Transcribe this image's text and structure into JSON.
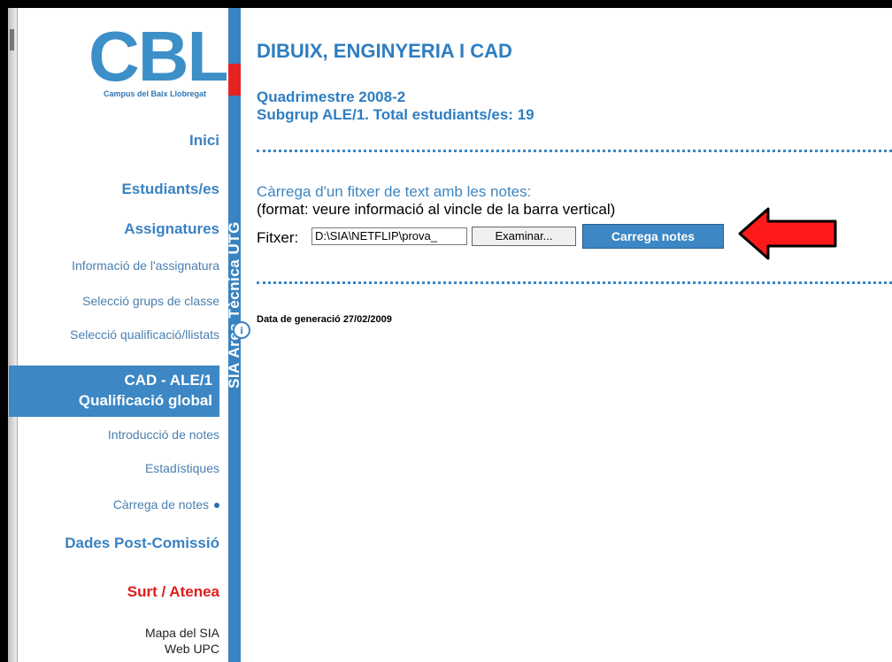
{
  "logo": {
    "word": "CBL",
    "subtitle": "Campus del Baix Llobregat"
  },
  "sidebar": {
    "items": [
      {
        "label": "Inici"
      },
      {
        "label": "Estudiants/es"
      },
      {
        "label": "Assignatures"
      },
      {
        "label": "Informació de l'assignatura"
      },
      {
        "label": "Selecció grups de classe"
      },
      {
        "label": "Selecció qualificació/llistats"
      },
      {
        "label": "Introducció de notes"
      },
      {
        "label": "Estadístiques"
      },
      {
        "label": "Càrrega de notes"
      },
      {
        "label": "Dades Post-Comissió"
      },
      {
        "label": "Surt / Atenea"
      },
      {
        "label": "Mapa del SIA"
      },
      {
        "label": "Web UPC"
      }
    ],
    "active": {
      "line1": "CAD - ALE/1",
      "line2": "Qualificació global"
    }
  },
  "vbar": {
    "text": "SIA  Àrea Tècnica UTG",
    "info_icon": "i"
  },
  "main": {
    "title": "DIBUIX, ENGINYERIA I CAD",
    "semester": "Quadrimestre 2008-2",
    "subgroup": "Subgrup ALE/1. Total estudiants/es: 19",
    "help": "Càrrega d'un fitxer de text amb les notes:",
    "help2": "(format: veure informació al vincle de la barra vertical)",
    "file_label": "Fitxer:",
    "file_value": "D:\\SIA\\NETFLIP\\prova_",
    "browse_label": "Examinar...",
    "submit_label": "Carrega notes",
    "generated": "Data de generació 27/02/2009"
  },
  "colors": {
    "accent": "#3c87c4",
    "red": "#e42222"
  }
}
